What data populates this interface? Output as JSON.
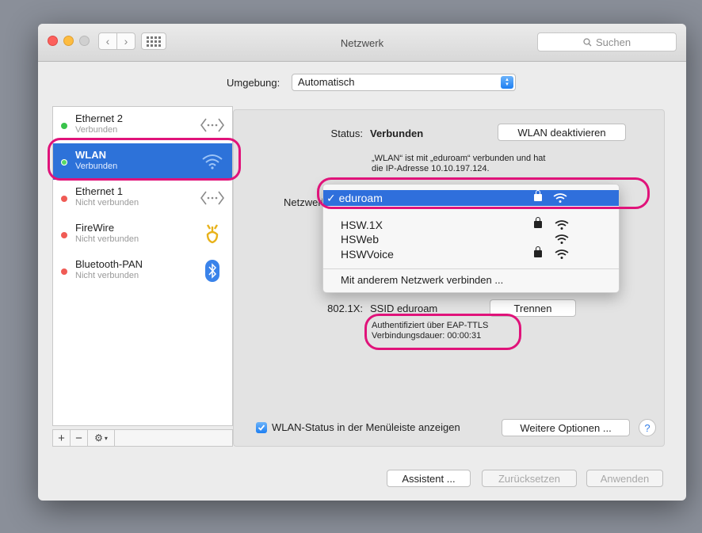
{
  "window": {
    "title": "Netzwerk"
  },
  "search": {
    "placeholder": "Suchen"
  },
  "location": {
    "label": "Umgebung:",
    "value": "Automatisch"
  },
  "sidebar": {
    "items": [
      {
        "name": "Ethernet 2",
        "status": "Verbunden",
        "icon": "ethernet-icon",
        "state": "green"
      },
      {
        "name": "WLAN",
        "status": "Verbunden",
        "icon": "wifi-icon",
        "state": "green"
      },
      {
        "name": "Ethernet 1",
        "status": "Nicht verbunden",
        "icon": "ethernet-icon",
        "state": "red"
      },
      {
        "name": "FireWire",
        "status": "Nicht verbunden",
        "icon": "firewire-icon",
        "state": "red"
      },
      {
        "name": "Bluetooth-PAN",
        "status": "Nicht verbunden",
        "icon": "bluetooth-icon",
        "state": "red"
      }
    ],
    "tools": {
      "add": "+",
      "remove": "−"
    }
  },
  "detail": {
    "status_label": "Status:",
    "status_value": "Verbunden",
    "wlan_off_button": "WLAN deaktivieren",
    "info_line1": "„WLAN“ ist mit „eduroam“ verbunden und hat",
    "info_line2": "die IP-Adresse 10.10.197.124.",
    "network_name_label": "Netzwerkname:",
    "dropdown": {
      "selected": "✓ eduroam",
      "networks": [
        {
          "name": "HSW.1X",
          "locked": true
        },
        {
          "name": "HSWeb",
          "locked": false
        },
        {
          "name": "HSWVoice",
          "locked": true
        }
      ],
      "other": "Mit anderem Netzwerk verbinden ..."
    },
    "x8021_label": "802.1X:",
    "x8021_value": "SSID eduroam",
    "disconnect_button": "Trennen",
    "auth_line1": "Authentifiziert über EAP-TTLS",
    "auth_line2": "Verbindungsdauer: 00:00:31",
    "menubar_checkbox": "WLAN-Status in der Menüleiste anzeigen",
    "more_options_button": "Weitere Optionen ...",
    "help": "?"
  },
  "footer": {
    "assistant_button": "Assistent ...",
    "reset_button": "Zurücksetzen",
    "apply_button": "Anwenden"
  },
  "colors": {
    "accent": "#2d72d9",
    "annotation": "#e0137a"
  }
}
